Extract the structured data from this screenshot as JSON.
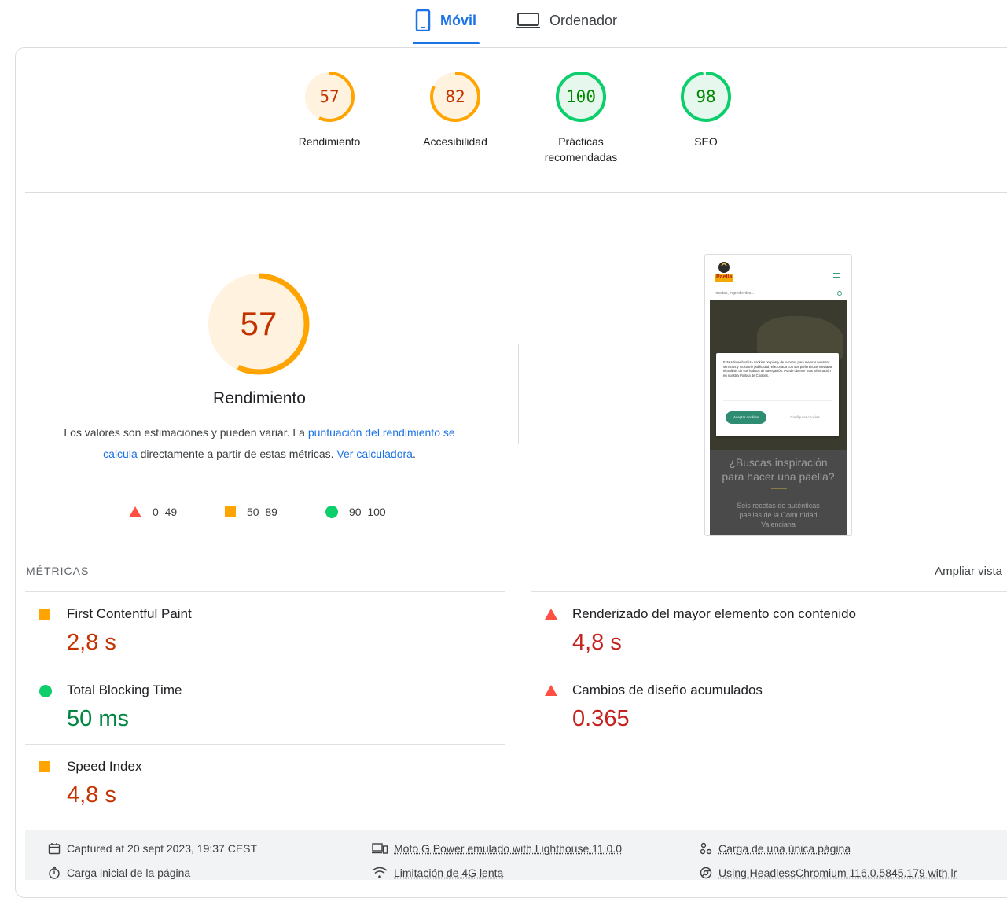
{
  "tabs": {
    "mobile": "Móvil",
    "desktop": "Ordenador"
  },
  "scores": [
    {
      "label": "Rendimiento",
      "value": "57",
      "fraction": 0.57,
      "color": "#ffa400",
      "text_color": "#c33300",
      "bg": "#fff3e0"
    },
    {
      "label": "Accesibilidad",
      "value": "82",
      "fraction": 0.82,
      "color": "#ffa400",
      "text_color": "#c33300",
      "bg": "#fff3e0"
    },
    {
      "label_line1": "Prácticas",
      "label_line2": "recomendadas",
      "value": "100",
      "fraction": 1.0,
      "color": "#0cce6b",
      "text_color": "#008800",
      "bg": "#e6f8ed"
    },
    {
      "label": "SEO",
      "value": "98",
      "fraction": 0.98,
      "color": "#0cce6b",
      "text_color": "#008800",
      "bg": "#e6f8ed"
    }
  ],
  "performance": {
    "score": "57",
    "title": "Rendimiento",
    "desc_part1": "Los valores son estimaciones y pueden variar. La ",
    "desc_link1": "puntuación del rendimiento se calcula",
    "desc_part2": " directamente a partir de estas métricas. ",
    "desc_link2": "Ver calculadora",
    "desc_part3": "."
  },
  "legend": {
    "fail": "0–49",
    "average": "50–89",
    "pass": "90–100"
  },
  "screenshot": {
    "logo": "Paella",
    "search_placeholder": "recetas, ingredientes...",
    "cookie_text": "Esta sitio web utiliza cookies propias y de terceros para mejorar nuestros servicios y mostrarle publicidad relacionada con sus preferencias mediante el análisis de sus hábitos de navegación. Puede obtener más información en nuestra Política de Cookies.",
    "accept": "Aceptar cookies",
    "configure": "Configurar cookies",
    "hero_line1": "¿Buscas inspiración",
    "hero_line2": "para hacer una paella?",
    "sub_line1": "Seis recetas de auténticas",
    "sub_line2": "paellas de la Comunidad",
    "sub_line3": "Valenciana"
  },
  "metrics": {
    "heading": "MÉTRICAS",
    "expand": "Ampliar vista",
    "fcp": {
      "name": "First Contentful Paint",
      "value": "2,8 s",
      "rating": "average"
    },
    "lcp": {
      "name": "Renderizado del mayor elemento con contenido",
      "value": "4,8 s",
      "rating": "fail"
    },
    "tbt": {
      "name": "Total Blocking Time",
      "value": "50 ms",
      "rating": "pass"
    },
    "cls": {
      "name": "Cambios de diseño acumulados",
      "value": "0.365",
      "rating": "fail"
    },
    "si": {
      "name": "Speed Index",
      "value": "4,8 s",
      "rating": "average"
    }
  },
  "colors": {
    "fail": "#ff4e42",
    "fail_text": "#c5221f",
    "average": "#ffa400",
    "average_text": "#c33300",
    "pass": "#0cce6b",
    "pass_text": "#018642",
    "link": "#1a73e8"
  },
  "footer": {
    "captured": "Captured at 20 sept 2023, 19:37 CEST",
    "initial_load": "Carga inicial de la página",
    "device": "Moto G Power emulado with Lighthouse 11.0.0",
    "throttling": "Limitación de 4G lenta",
    "single_page": "Carga de una única página",
    "browser": "Using HeadlessChromium 116.0.5845.179 with lr"
  }
}
